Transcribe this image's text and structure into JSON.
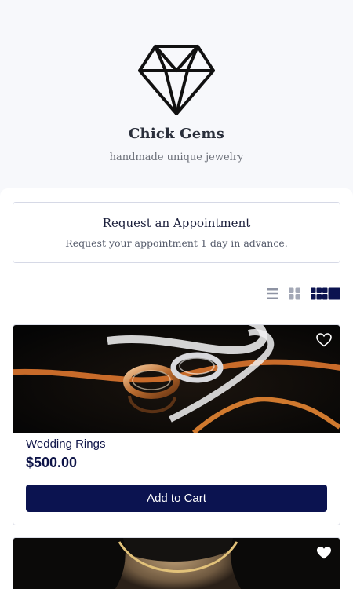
{
  "store": {
    "name": "Chick Gems",
    "tagline": "handmade unique jewelry"
  },
  "appointment": {
    "title": "Request an Appointment",
    "subtitle": "Request your appointment 1 day in advance."
  },
  "view_options": {
    "icons": [
      "list-view-icon",
      "grid-view-icon",
      "large-grid-view-icon"
    ],
    "selected": "large-grid-view-icon"
  },
  "products": [
    {
      "name": "Wedding Rings",
      "price": "$500.00",
      "button_label": "Add to Cart",
      "favorite_icon": "heart-outline-icon"
    },
    {
      "favorite_icon": "heart-filled-icon"
    }
  ],
  "colors": {
    "header_bg": "#f7f8fb",
    "accent": "#0b1350",
    "text_dark": "#0e1448",
    "border": "#d6d9e6"
  }
}
